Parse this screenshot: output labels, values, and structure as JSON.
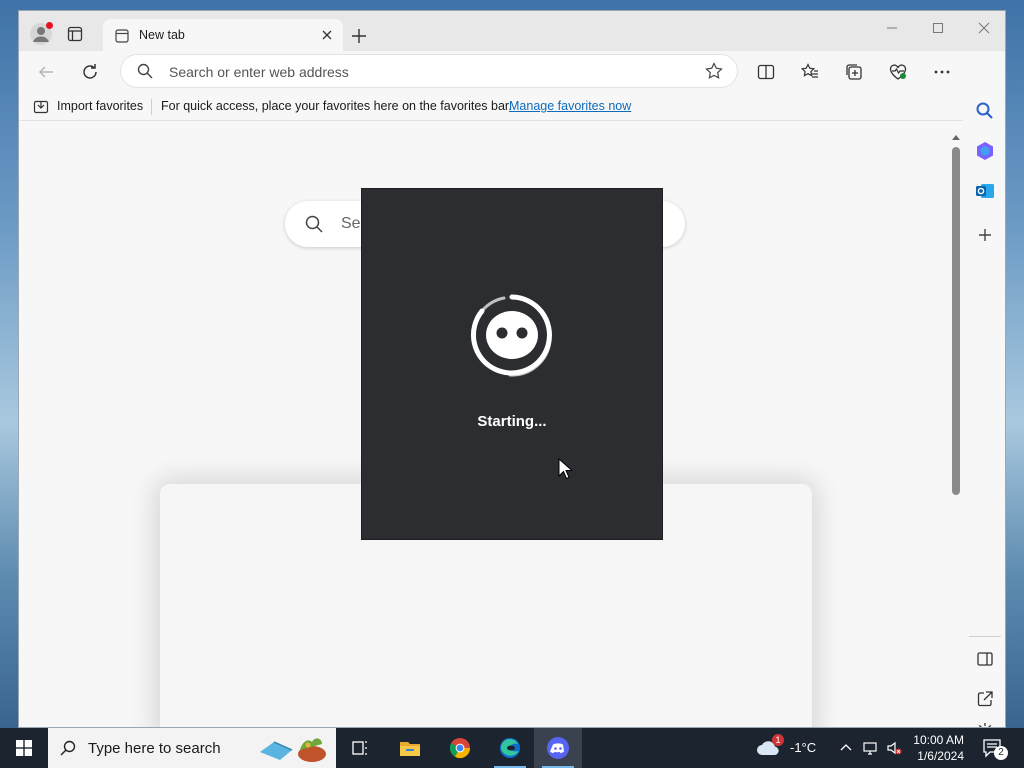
{
  "browser": {
    "tab": {
      "title": "New tab"
    },
    "address": {
      "placeholder": "Search or enter web address"
    },
    "favorites_bar": {
      "import_label": "Import favorites",
      "hint": "For quick access, place your favorites here on the favorites bar.",
      "manage_link": "Manage favorites now"
    },
    "page": {
      "search_placeholder": "Sea"
    }
  },
  "splash": {
    "app": "Discord",
    "status": "Starting..."
  },
  "taskbar": {
    "search_placeholder": "Type here to search",
    "apps": [
      "task-view",
      "file-explorer",
      "chrome",
      "edge",
      "discord"
    ],
    "weather": {
      "temp": "-1°C",
      "badge": "1"
    },
    "clock": {
      "time": "10:00 AM",
      "date": "1/6/2024"
    },
    "notifications": "2"
  },
  "colors": {
    "splash_bg": "#2b2d31",
    "taskbar_bg": "#1c2430",
    "link": "#0f6cbd",
    "accent": "#76b9ed"
  }
}
